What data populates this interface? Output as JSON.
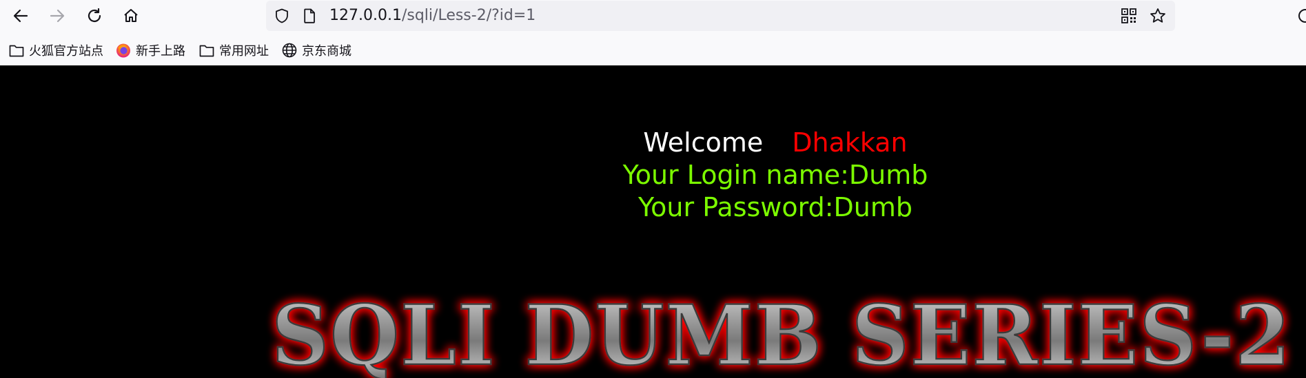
{
  "browser": {
    "url_host": "127.0.0.1",
    "url_path": "/sqli/Less-2/?id=1",
    "bookmarks": [
      {
        "label": "火狐官方站点",
        "icon": "folder-icon"
      },
      {
        "label": "新手上路",
        "icon": "firefox-icon"
      },
      {
        "label": "常用网址",
        "icon": "folder-icon"
      },
      {
        "label": "京东商城",
        "icon": "globe-icon"
      }
    ]
  },
  "page": {
    "welcome": "Welcome",
    "username": "Dhakkan",
    "login_line": "Your Login name:Dumb",
    "password_line": "Your Password:Dumb",
    "banner_text": "SQLI DUMB SERIES-2"
  },
  "colors": {
    "background": "#000000",
    "welcome": "#ffffff",
    "username": "#ff0000",
    "result_text": "#7cfc00",
    "banner_glow": "#ff0000"
  }
}
